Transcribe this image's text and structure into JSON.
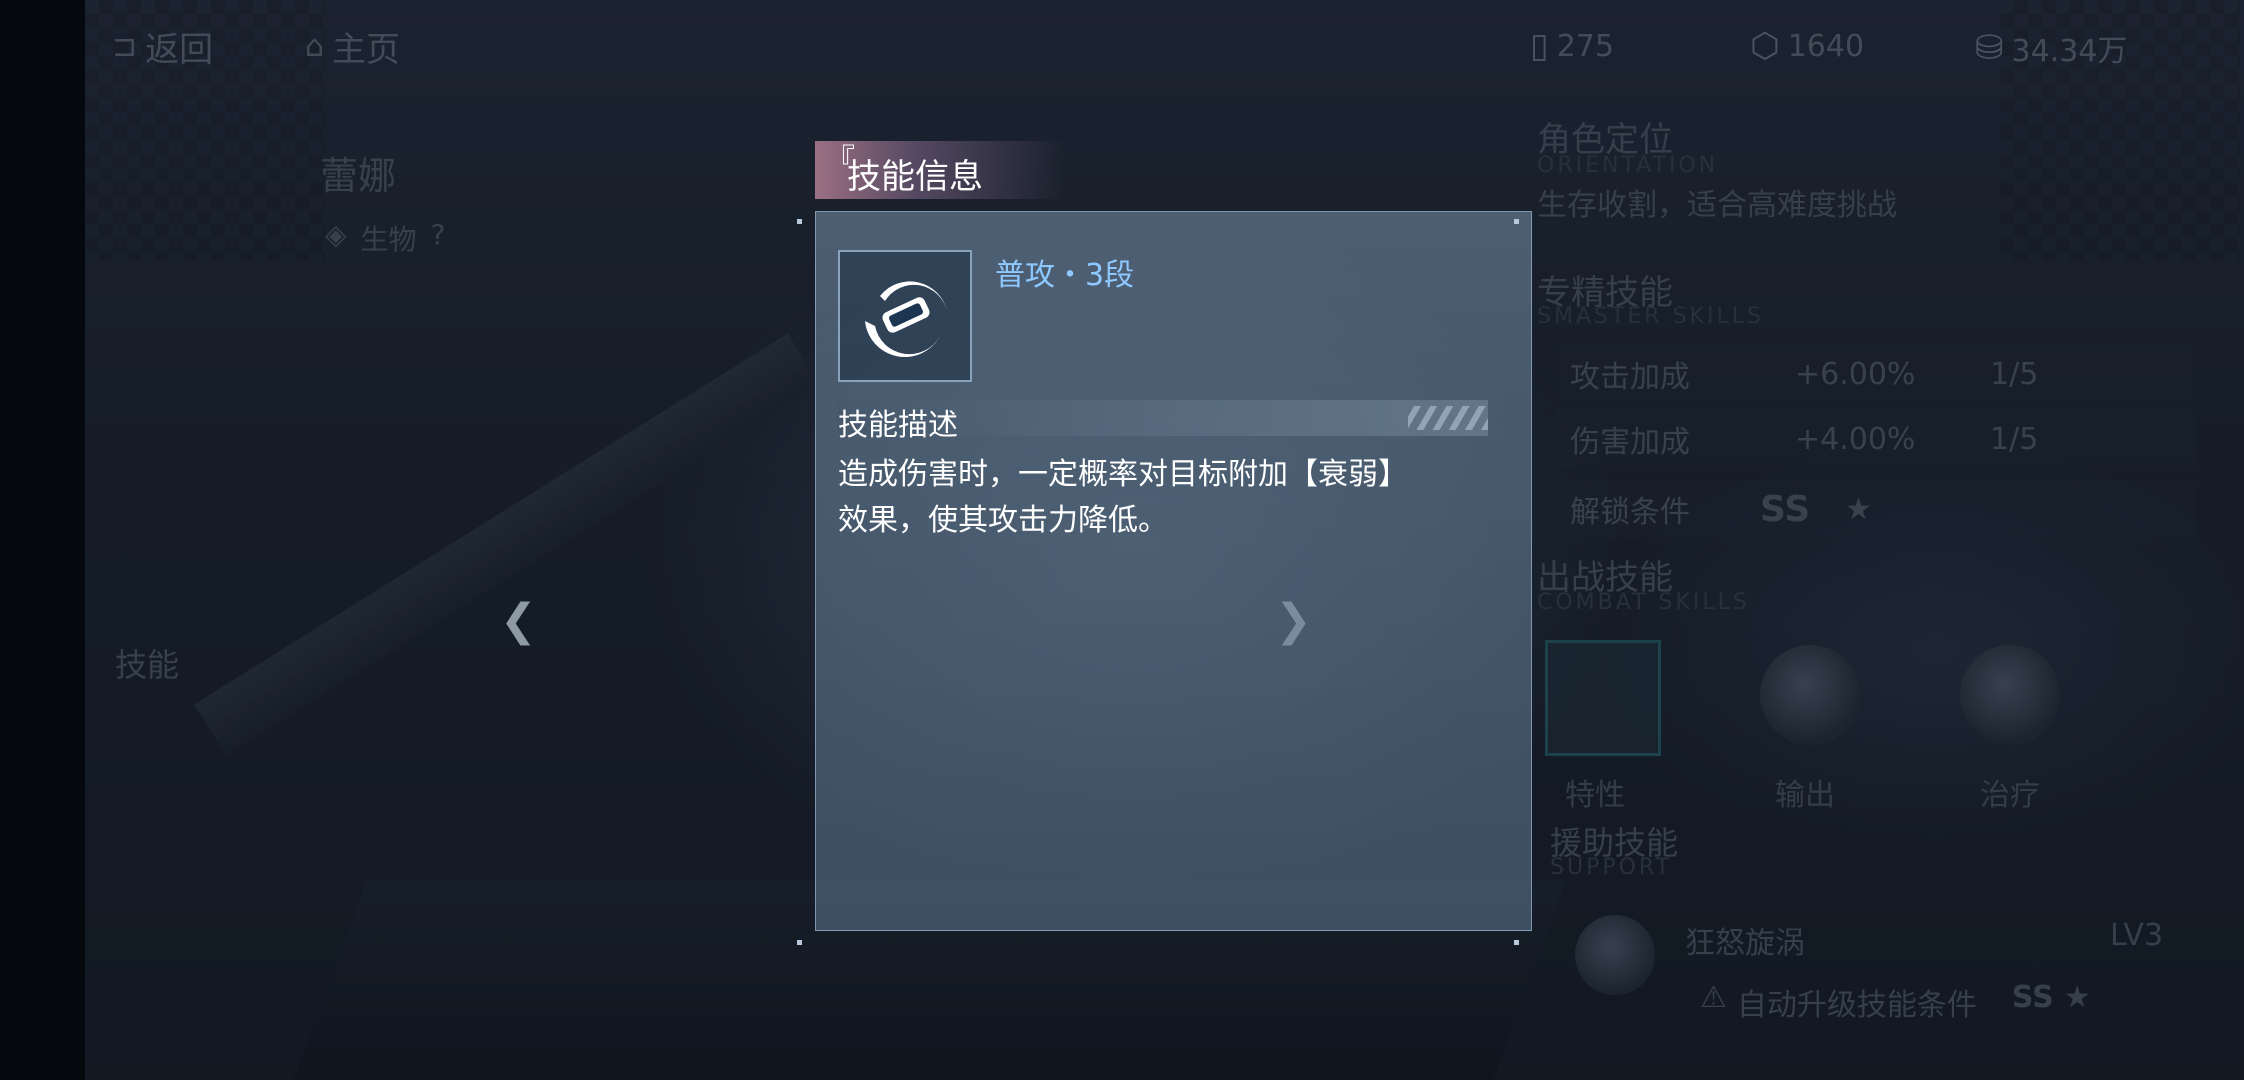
{
  "topbar": {
    "back_label": "返回",
    "home_label": "主页",
    "resources": [
      {
        "icon": "battery-icon",
        "value": "275"
      },
      {
        "icon": "cube-icon",
        "value": "1640"
      },
      {
        "icon": "money-basket-icon",
        "value": "34.34万"
      }
    ]
  },
  "character": {
    "name": "蕾娜",
    "attribute": "生物",
    "help": "?",
    "side_tab": "技能"
  },
  "right_panel": {
    "role_title": "角色定位",
    "role_en": "ORIENTATION",
    "role_desc": "生存收割，适合高难度挑战",
    "master_title": "专精技能",
    "master_en": "SMASTER SKILLS",
    "master_rows": [
      {
        "name": "攻击加成",
        "value": "+6.00%",
        "level": "1/5"
      },
      {
        "name": "伤害加成",
        "value": "+4.00%",
        "level": "1/5"
      }
    ],
    "unlock_label": "解锁条件",
    "unlock_rank": "SS",
    "combat_title": "出战技能",
    "combat_en": "COMBAT SKILLS",
    "combat_skills": [
      "特性",
      "输出",
      "治疗"
    ],
    "support_title": "援助技能",
    "support_en": "SUPPORT",
    "support_skill": "狂怒旋涡",
    "support_level": "LV3",
    "auto_upgrade": "自动升级技能条件",
    "auto_rank": "SS"
  },
  "dialog": {
    "title": "技能信息",
    "skill_name": "普攻・3段",
    "desc_header": "技能描述",
    "desc_line1": "造成伤害时，一定概率对目标附加【衰弱】",
    "desc_line2": "效果，使其攻击力降低。"
  },
  "colors": {
    "accent_blue": "#8ec8ff",
    "title_pink": "#aa788c",
    "panel": "#6c88a3"
  }
}
